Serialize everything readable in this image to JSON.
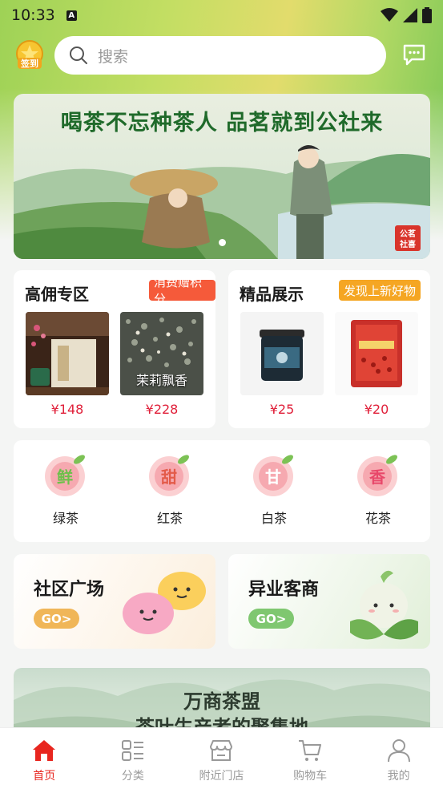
{
  "status": {
    "time": "10:33",
    "notif_badge": "A"
  },
  "header": {
    "signin_badge": "签到",
    "search_placeholder": "搜索",
    "search_icon": "search-icon",
    "message_icon": "message-icon"
  },
  "banner": {
    "title": "喝茶不忘种茶人 品茗就到公社来",
    "seal_text": "公茗社喜",
    "slide_count": 1
  },
  "commission": {
    "title": "高佣专区",
    "tag": "消费赠积分",
    "tag_color": "#f55a3a",
    "products": [
      {
        "price": "¥148",
        "image_text": ""
      },
      {
        "price": "¥228",
        "image_text": "茉莉飘香"
      }
    ]
  },
  "featured": {
    "title": "精品展示",
    "tag": "发现上新好物",
    "tag_color": "#f5a623",
    "products": [
      {
        "price": "¥25"
      },
      {
        "price": "¥20"
      }
    ]
  },
  "categories": [
    {
      "icon_char": "鲜",
      "label": "绿茶"
    },
    {
      "icon_char": "甜",
      "label": "红茶"
    },
    {
      "icon_char": "甘",
      "label": "白茶"
    },
    {
      "icon_char": "香",
      "label": "花茶"
    }
  ],
  "promos": [
    {
      "title": "社区广场",
      "go": "GO>",
      "accent": "#f0b658"
    },
    {
      "title": "异业客商",
      "go": "GO>",
      "accent": "#7fc770"
    }
  ],
  "bottom_banner": {
    "line1": "万商茶盟",
    "line2": "茶叶生产者的聚集地"
  },
  "tabbar": [
    {
      "label": "首页",
      "icon": "home-icon",
      "active": true
    },
    {
      "label": "分类",
      "icon": "category-icon",
      "active": false
    },
    {
      "label": "附近门店",
      "icon": "store-icon",
      "active": false
    },
    {
      "label": "购物车",
      "icon": "cart-icon",
      "active": false
    },
    {
      "label": "我的",
      "icon": "profile-icon",
      "active": false
    }
  ],
  "colors": {
    "accent_red": "#e8261f",
    "price_red": "#e0203a"
  }
}
